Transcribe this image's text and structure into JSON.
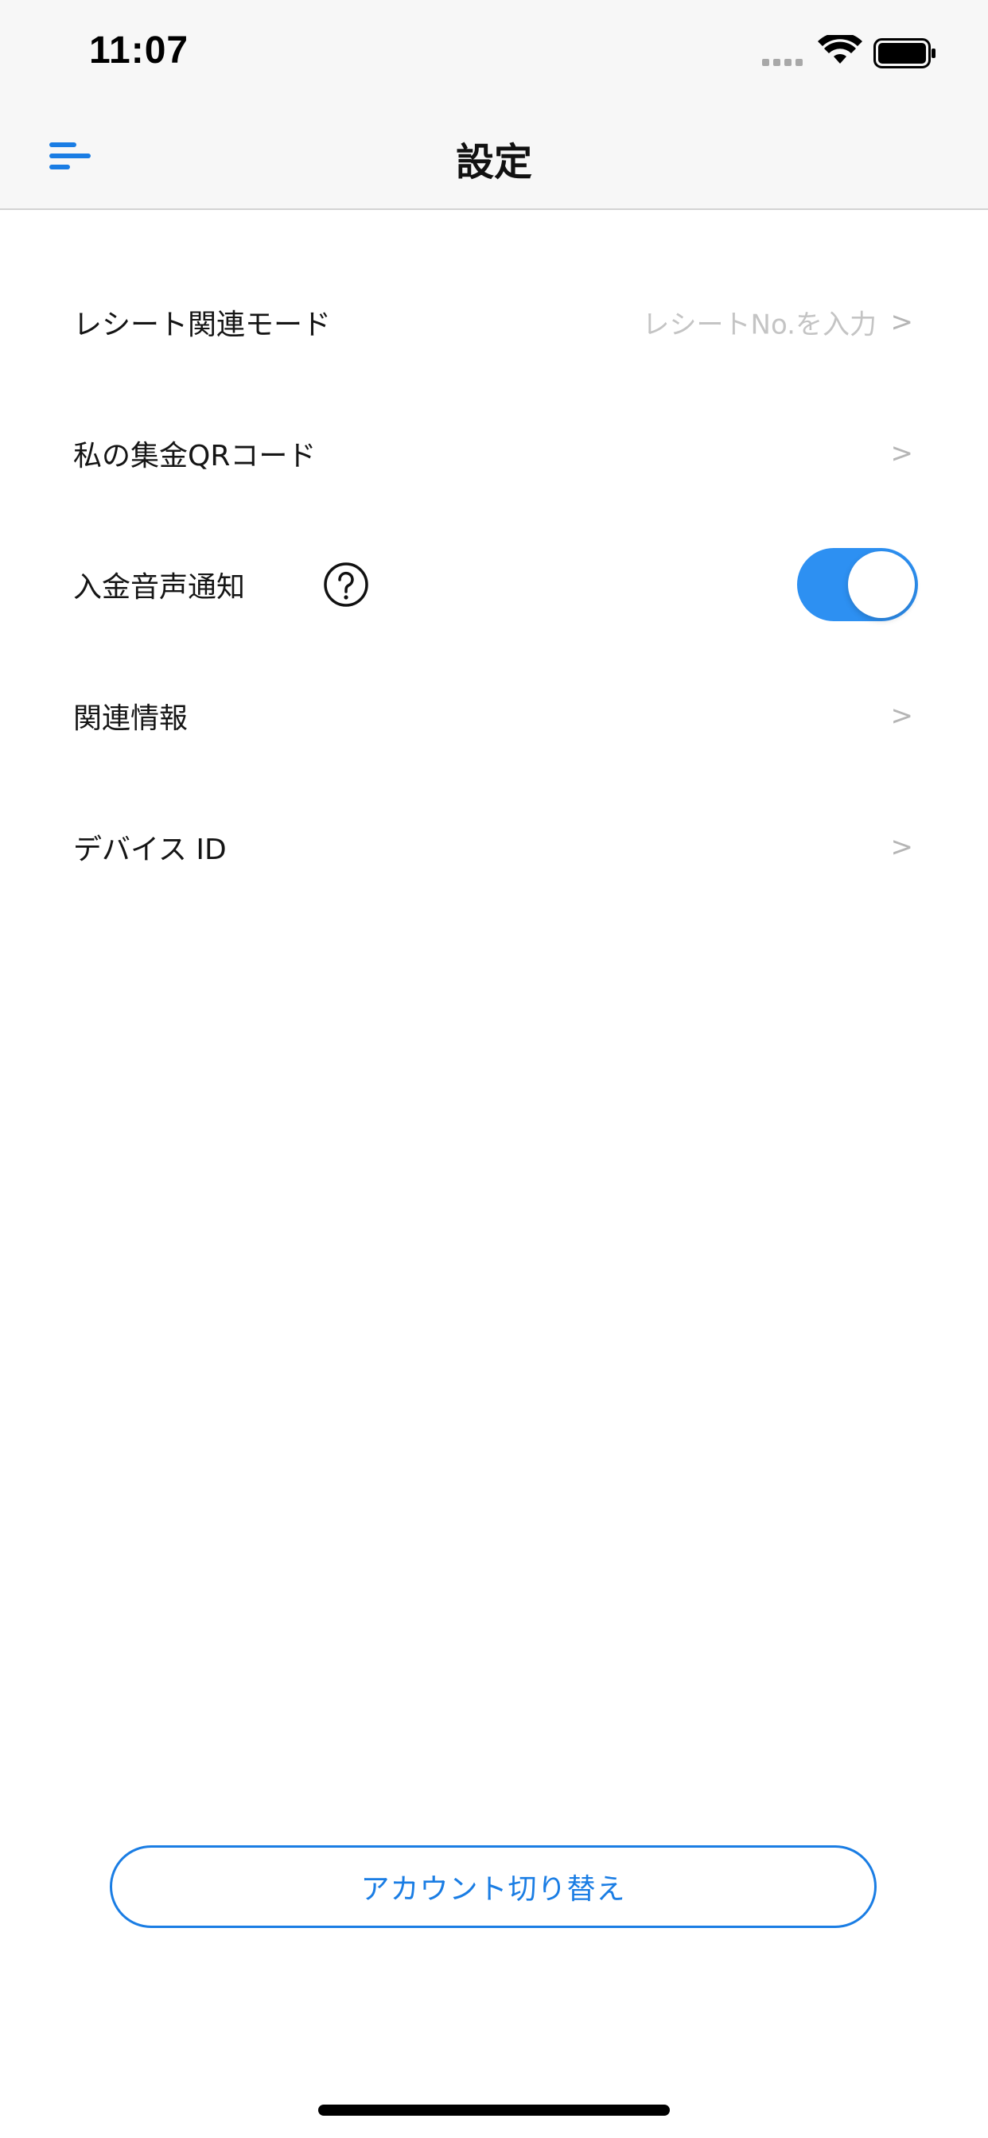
{
  "status_bar": {
    "time": "11:07",
    "icons": [
      "cellular-signal-icon",
      "wifi-icon",
      "battery-icon"
    ]
  },
  "header": {
    "title": "設定",
    "menu_icon": "menu-icon"
  },
  "settings": {
    "items": [
      {
        "label": "レシート関連モード",
        "value": "レシートNo.を入力",
        "chevron": ">"
      },
      {
        "label": "私の集金QRコード",
        "value": "",
        "chevron": ">"
      },
      {
        "label": "入金音声通知",
        "help_icon": "question-circle-icon",
        "toggle_on": true
      },
      {
        "label": "関連情報",
        "value": "",
        "chevron": ">"
      },
      {
        "label": "デバイス ID",
        "value": "",
        "chevron": ">"
      }
    ]
  },
  "footer": {
    "switch_account_label": "アカウント切り替え"
  },
  "colors": {
    "accent": "#1a7de4",
    "toggle_on": "#2d90f2",
    "header_bg": "#f7f7f7",
    "secondary_text": "#c4c4c4"
  }
}
